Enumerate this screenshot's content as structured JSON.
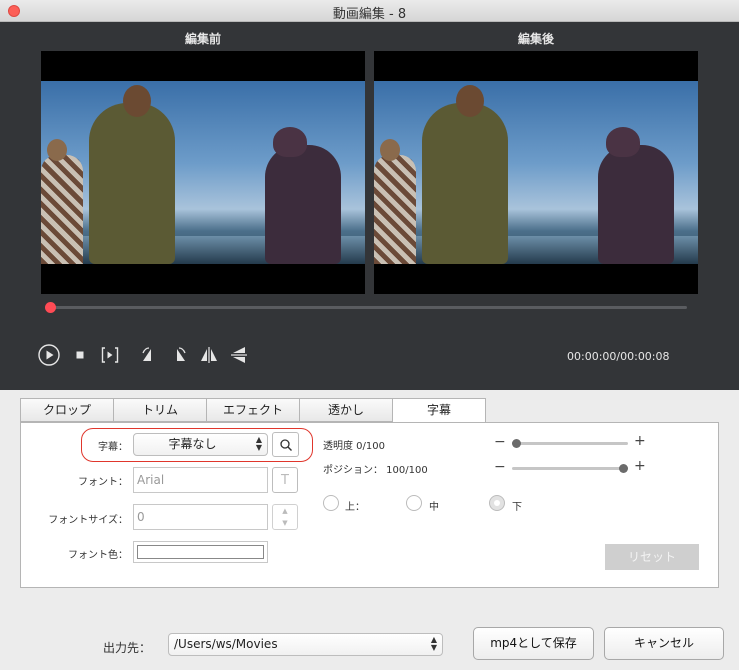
{
  "window": {
    "title": "動画編集 - 8"
  },
  "preview": {
    "before_label": "編集前",
    "after_label": "編集後",
    "timecode": "00:00:00/00:00:08",
    "progress": 0.0
  },
  "tabs": [
    {
      "label": "クロップ",
      "active": false
    },
    {
      "label": "トリム",
      "active": false
    },
    {
      "label": "エフェクト",
      "active": false
    },
    {
      "label": "透かし",
      "active": false
    },
    {
      "label": "字幕",
      "active": true
    }
  ],
  "subtitle": {
    "subtitle_label": "字幕：",
    "subtitle_value": "字幕なし",
    "font_label": "フォント：",
    "font_value": "Arial",
    "fontsize_label": "フォントサイズ：",
    "fontsize_value": "0",
    "fontcolor_label": "フォント色：",
    "opacity_label": "透明度 0/100",
    "opacity_value": 0,
    "position_label": "ポジション： 100/100",
    "position_value": 100,
    "radio_top": "上：",
    "radio_middle": "中",
    "radio_bottom": "下",
    "selected_position": "下",
    "reset_label": "リセット"
  },
  "footer": {
    "output_label": "出力先：",
    "output_path": "/Users/ws/Movies",
    "save_label": "mp4として保存",
    "cancel_label": "キャンセル"
  },
  "colors": {
    "accent": "#ff4b55",
    "highlight": "#e0362c",
    "dark_bg": "#333538"
  }
}
